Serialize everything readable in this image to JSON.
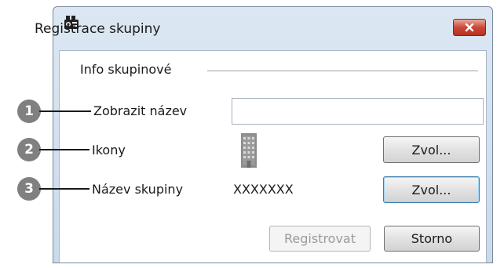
{
  "window": {
    "title": "Registrace skupiny",
    "icons": {
      "app": "projector-group-icon",
      "close": "close-icon"
    }
  },
  "group": {
    "label": "Info skupinové"
  },
  "fields": {
    "display_name": {
      "label": "Zobrazit název",
      "value": ""
    },
    "icons": {
      "label": "Ikony",
      "icon": "building-icon",
      "button_label": "Zvol..."
    },
    "group_name": {
      "label": "Název skupiny",
      "value": "XXXXXXX",
      "button_label": "Zvol..."
    }
  },
  "actions": {
    "register_label": "Registrovat",
    "cancel_label": "Storno"
  },
  "callouts": [
    "1",
    "2",
    "3"
  ],
  "colors": {
    "titlebar": "#dce7f3",
    "close_button": "#c9483a",
    "focus_border": "#3c7fb1",
    "callout": "#808080",
    "building_icon": "#8c8c8c"
  }
}
